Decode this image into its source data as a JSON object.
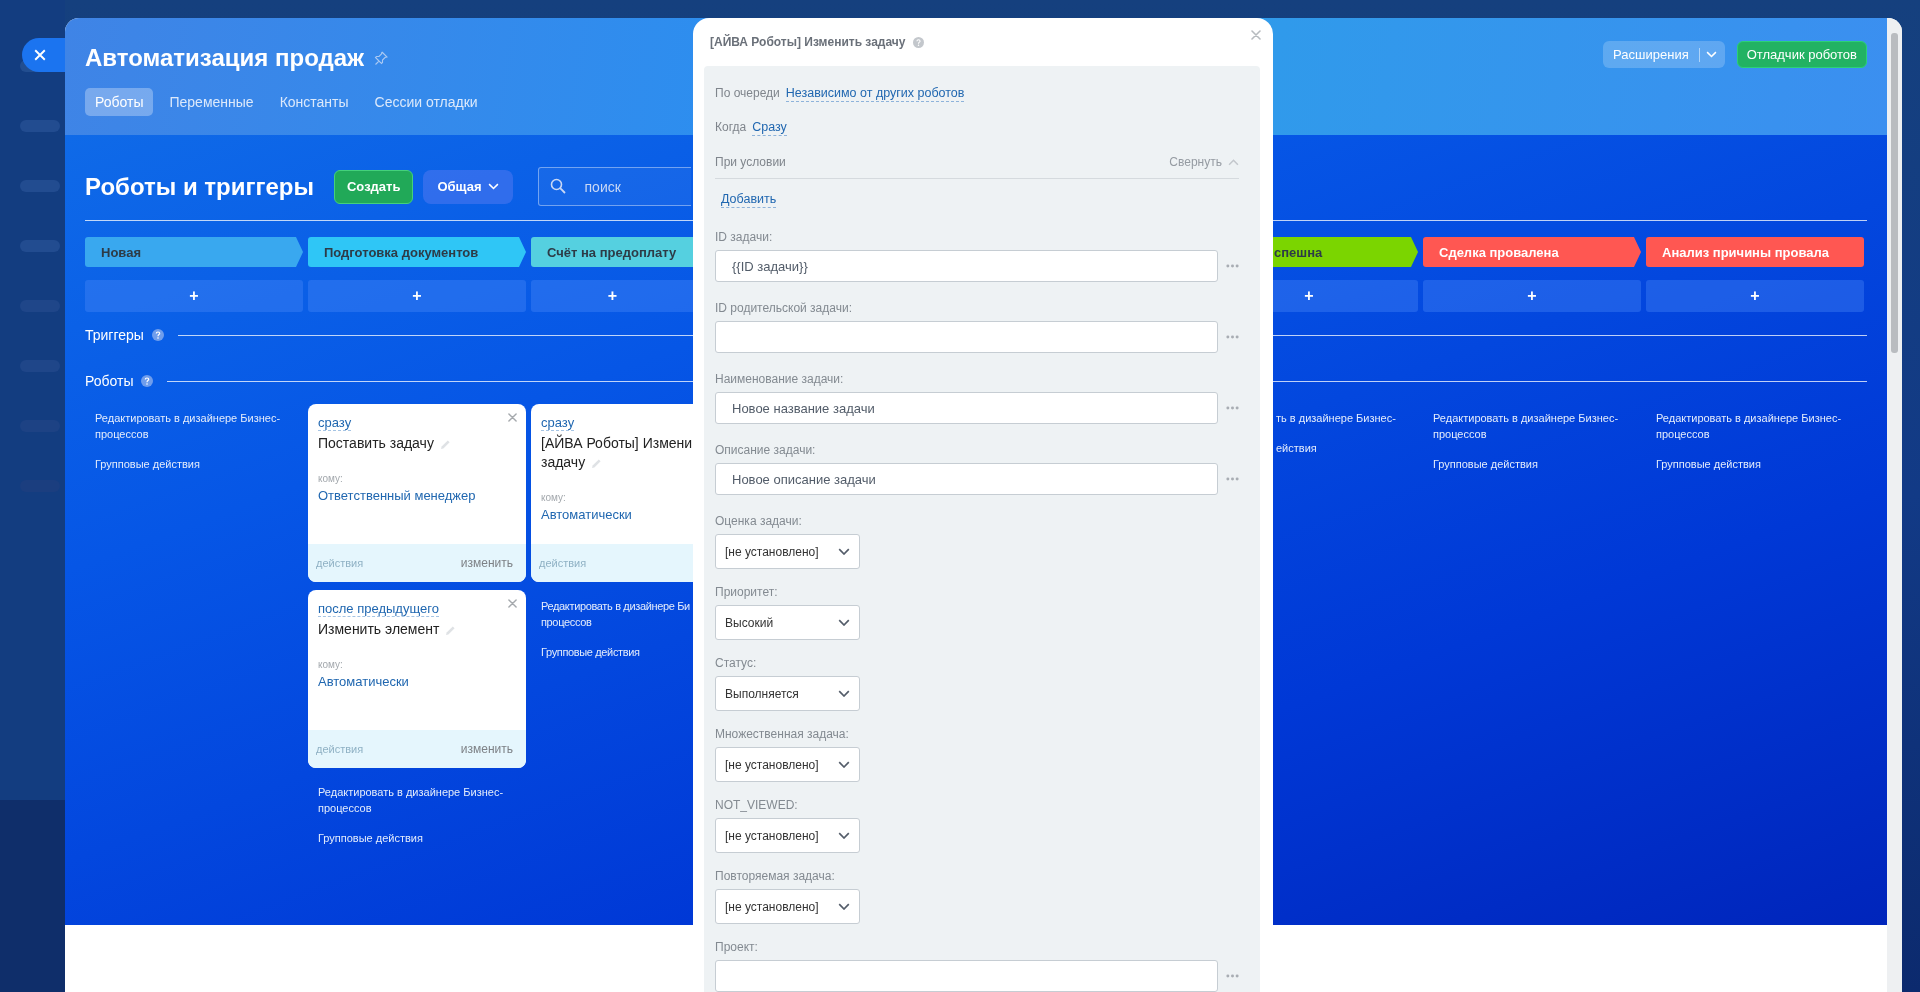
{
  "header": {
    "title": "Автоматизация продаж",
    "tabs": [
      {
        "label": "Роботы",
        "selected": true
      },
      {
        "label": "Переменные",
        "selected": false
      },
      {
        "label": "Константы",
        "selected": false
      },
      {
        "label": "Сессии отладки",
        "selected": false
      }
    ],
    "extensions_button": "Расширения",
    "debugger_button": "Отладчик роботов"
  },
  "toolbar": {
    "title": "Роботы и триггеры",
    "create_button": "Создать",
    "filter_button": "Общая",
    "search": {
      "placeholder": "поиск"
    }
  },
  "sections": [
    {
      "title": "Триггеры"
    },
    {
      "title": "Роботы"
    }
  ],
  "columns": [
    {
      "stage": {
        "label": "Новая",
        "color": "#39a8ef"
      },
      "add_label": "+",
      "links": [
        "Редактировать в дизайнере Бизнес-процессов",
        "Групповые действия"
      ]
    },
    {
      "stage": {
        "label": "Подготовка документов",
        "color": "#2fc6f6"
      },
      "add_label": "+",
      "robots": [
        {
          "delay": "сразу",
          "title": "Поставить задачу",
          "to_label": "кому:",
          "to": "Ответственный менеджер",
          "actions": "действия",
          "edit": "изменить"
        },
        {
          "delay": "после предыдущего",
          "title": "Изменить элемент",
          "to_label": "кому:",
          "to": "Автоматически",
          "actions": "действия",
          "edit": "изменить"
        }
      ],
      "links": [
        "Редактировать в дизайнере Бизнес-процессов",
        "Групповые действия"
      ]
    },
    {
      "stage": {
        "label": "Счёт на предоплату",
        "color": "#55d0e0"
      },
      "add_label": "+",
      "robots": [
        {
          "delay": "сразу",
          "title": "[АЙВА Роботы] Измени задачу",
          "to_label": "кому:",
          "to": "Автоматически",
          "actions": "действия"
        }
      ],
      "links": [
        "Редактировать в дизайнере Би процессов",
        "Групповые действия"
      ]
    },
    {
      "stage": {
        "label": "спешна",
        "color": "#7bd500"
      },
      "add_label": "+",
      "links": [
        "ть в дизайнере Бизнес-",
        "ействия"
      ]
    },
    {
      "stage": {
        "label": "Сделка провалена",
        "color": "#ff5752"
      },
      "add_label": "+",
      "links": [
        "Редактировать в дизайнере Бизнес-процессов",
        "Групповые действия"
      ]
    },
    {
      "stage": {
        "label": "Анализ причины провала",
        "color": "#ff5752"
      },
      "add_label": "+",
      "links": [
        "Редактировать в дизайнере Бизнес-процессов",
        "Групповые действия"
      ]
    }
  ],
  "dialog": {
    "title": "[АЙВА Роботы] Изменить задачу",
    "order": {
      "label": "По очереди",
      "value": "Независимо от других роботов"
    },
    "when": {
      "label": "Когда",
      "value": "Сразу"
    },
    "condition": {
      "label": "При условии",
      "collapse": "Свернуть",
      "add": "Добавить"
    },
    "fields": [
      {
        "kind": "text",
        "label": "ID задачи:",
        "value": "{{ID задачи}}"
      },
      {
        "kind": "text",
        "label": "ID родительской задачи:"
      },
      {
        "kind": "text",
        "label": "Наименование задачи:",
        "value": "Новое название задачи"
      },
      {
        "kind": "text",
        "label": "Описание задачи:",
        "value": "Новое описание задачи"
      },
      {
        "kind": "select",
        "label": "Оценка задачи:",
        "value": "[не установлено]"
      },
      {
        "kind": "select",
        "label": "Приоритет:",
        "value": "Высокий"
      },
      {
        "kind": "select",
        "label": "Статус:",
        "value": "Выполняется"
      },
      {
        "kind": "select",
        "label": "Множественная задача:",
        "value": "[не установлено]"
      },
      {
        "kind": "select",
        "label": "NOT_VIEWED:",
        "value": "[не установлено]"
      },
      {
        "kind": "select",
        "label": "Повторяемая задача:",
        "value": "[не установлено]"
      },
      {
        "kind": "text",
        "label": "Проект:"
      }
    ]
  }
}
